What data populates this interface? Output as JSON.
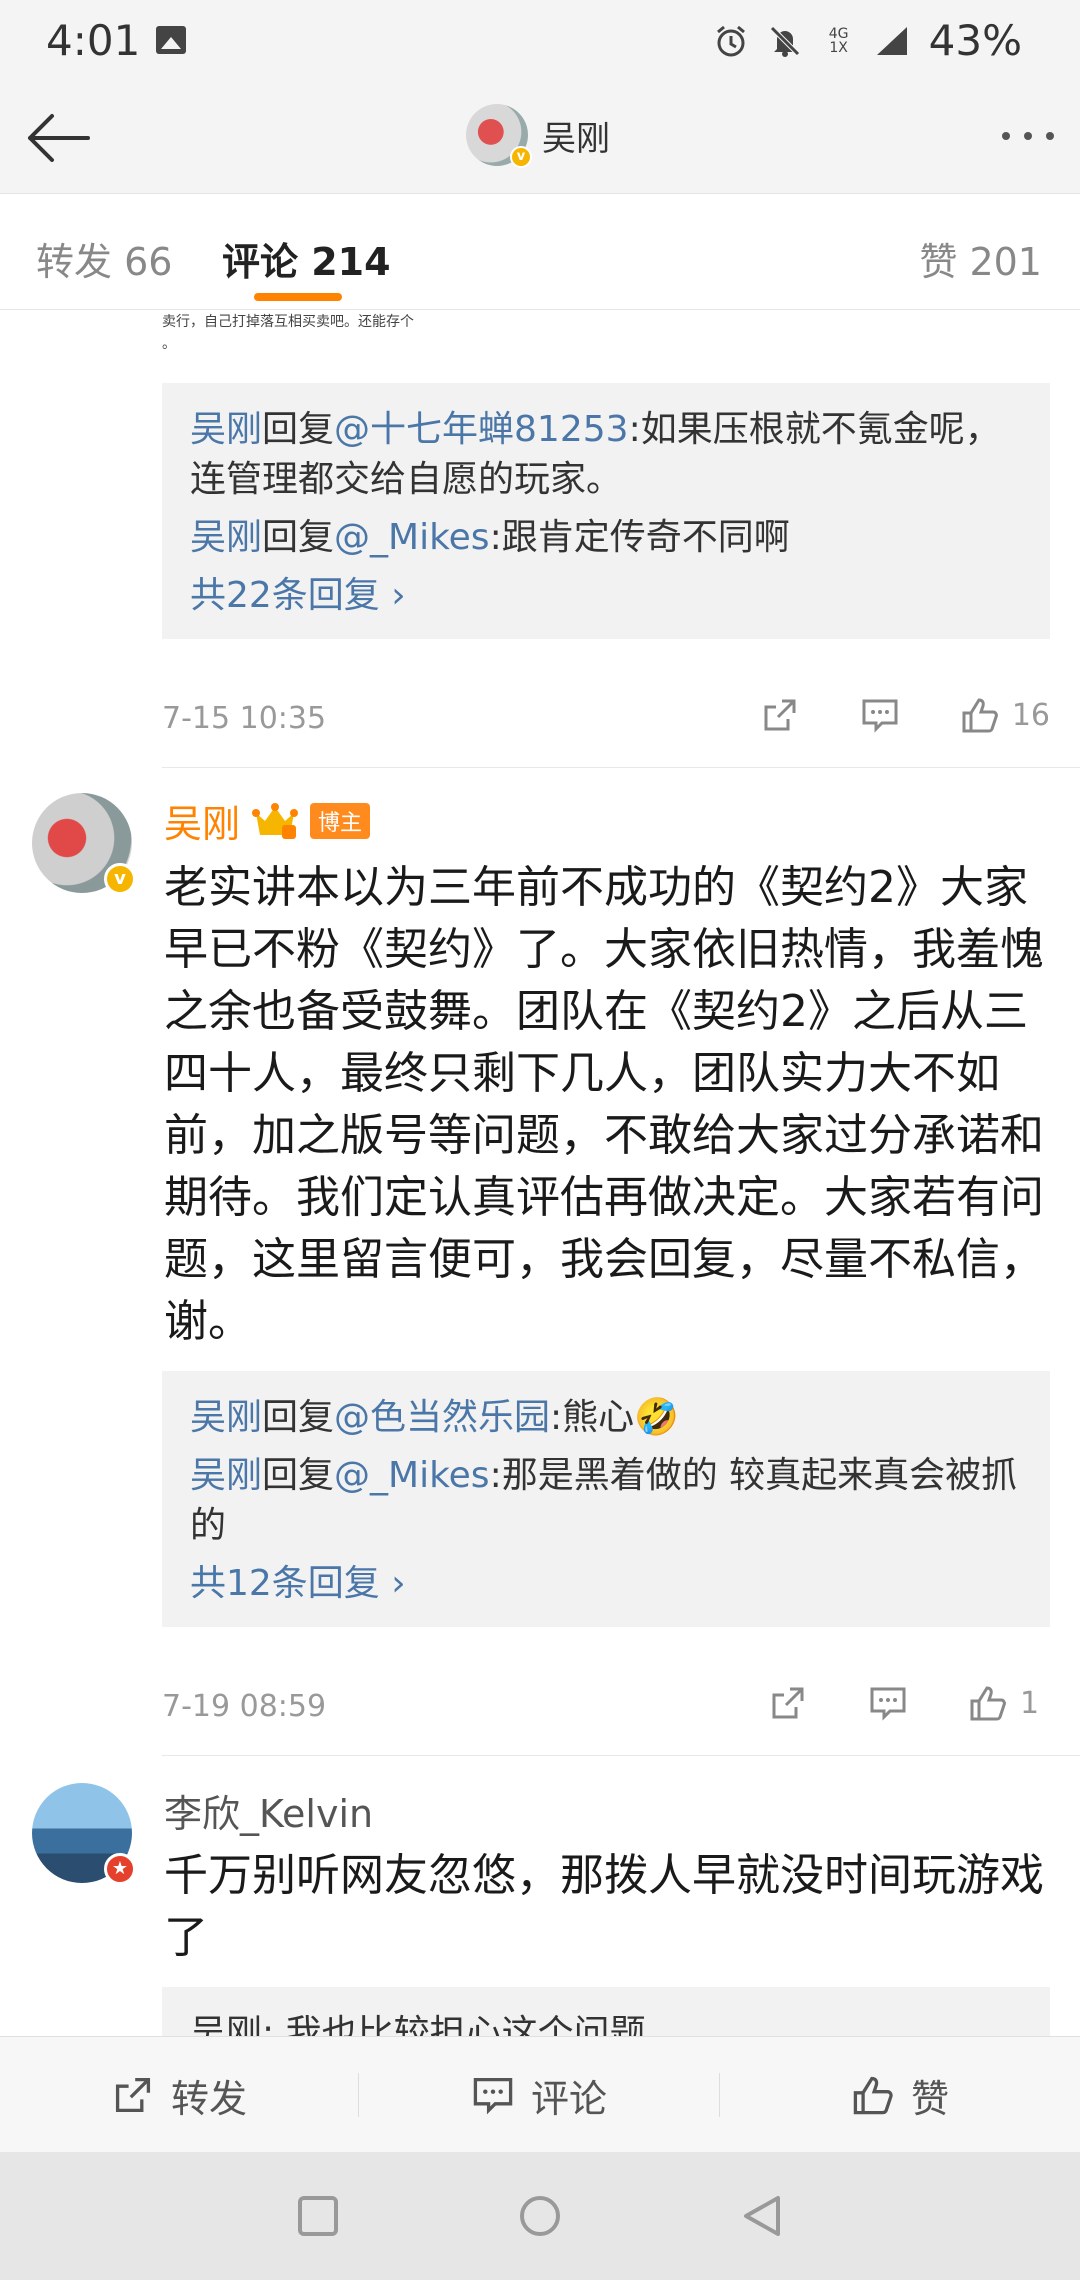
{
  "status_bar": {
    "time": "4:01",
    "network_top": "4G",
    "network_bottom": "1X",
    "battery": "43%"
  },
  "header": {
    "title": "吴刚"
  },
  "tabs": {
    "repost": "转发 66",
    "comments": "评论 214",
    "likes": "赞 201"
  },
  "clipped_image_text": [
    "卖行，自己打掉落互相买卖吧。还能存个",
    "。"
  ],
  "comment1": {
    "replies": [
      {
        "user": "吴刚",
        "verb": "回复",
        "target": "@十七年蝉81253",
        "text": ":如果压根就不氪金呢，连管理都交给自愿的玩家。"
      },
      {
        "user": "吴刚",
        "verb": "回复",
        "target": "@_Mikes",
        "text": ":跟肯定传奇不同啊"
      }
    ],
    "more_replies": "共22条回复 ›",
    "time": "7-15 10:35",
    "like_count": "16"
  },
  "comment2": {
    "author": "吴刚",
    "tag": "博主",
    "text": "老实讲本以为三年前不成功的《契约2》大家早已不粉《契约》了。大家依旧热情，我羞愧之余也备受鼓舞。团队在《契约2》之后从三四十人，最终只剩下几人，团队实力大不如前，加之版号等问题，不敢给大家过分承诺和期待。我们定认真评估再做决定。大家若有问题，这里留言便可，我会回复，尽量不私信，谢。",
    "replies": [
      {
        "user": "吴刚",
        "verb": "回复",
        "target": "@色当然乐园",
        "text": ":熊心🤣"
      },
      {
        "user": "吴刚",
        "verb": "回复",
        "target": "@_Mikes",
        "text": ":那是黑着做的 较真起来真会被抓的"
      }
    ],
    "more_replies": "共12条回复 ›",
    "time": "7-19 08:59",
    "like_count": "1"
  },
  "comment3": {
    "author": "李欣_Kelvin",
    "text": "千万别听网友忽悠，那拨人早就没时间玩游戏了",
    "reply_peek": "吴刚: 我也比较担心这个问题"
  },
  "bottom_bar": {
    "repost": "转发",
    "comment": "评论",
    "like": "赞"
  },
  "colors": {
    "accent": "#ff8200",
    "link": "#4b77a8",
    "reply_bg": "#f2f2f2"
  }
}
